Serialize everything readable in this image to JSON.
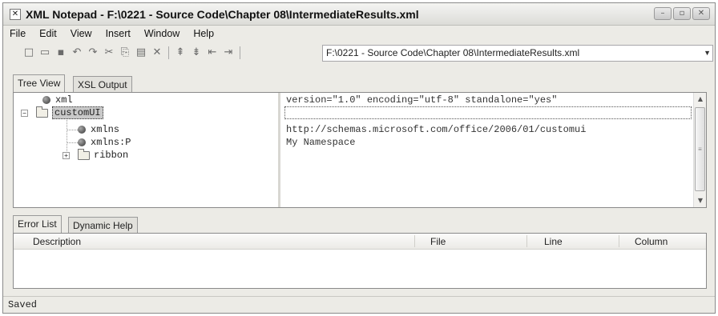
{
  "window": {
    "title": "XML Notepad - F:\\0221 - Source Code\\Chapter 08\\IntermediateResults.xml",
    "app_icon_glyph": "✕",
    "minimize_glyph": "–",
    "restore_glyph": "▫",
    "close_glyph": "✕"
  },
  "menu": [
    "File",
    "Edit",
    "View",
    "Insert",
    "Window",
    "Help"
  ],
  "toolbar": {
    "icons": [
      {
        "name": "new-file-icon",
        "glyph": "□"
      },
      {
        "name": "open-folder-icon",
        "glyph": "▭"
      },
      {
        "name": "save-icon",
        "glyph": "▪"
      },
      {
        "name": "undo-icon",
        "glyph": "↶"
      },
      {
        "name": "redo-icon",
        "glyph": "↷"
      },
      {
        "name": "cut-icon",
        "glyph": "✂"
      },
      {
        "name": "copy-icon",
        "glyph": "⎘"
      },
      {
        "name": "paste-icon",
        "glyph": "▤"
      },
      {
        "name": "delete-icon",
        "glyph": "✕"
      },
      {
        "name": "nudge-up-icon",
        "glyph": "⇞"
      },
      {
        "name": "nudge-down-icon",
        "glyph": "⇟"
      },
      {
        "name": "nudge-left-icon",
        "glyph": "⇤"
      },
      {
        "name": "nudge-right-icon",
        "glyph": "⇥"
      }
    ],
    "path_value": "F:\\0221 - Source Code\\Chapter 08\\IntermediateResults.xml",
    "path_dropdown_glyph": "▼"
  },
  "top_tabs": [
    "Tree View",
    "XSL Output"
  ],
  "tree": {
    "nodes": [
      "xml",
      "customUI",
      "xmlns",
      "xmlns:P",
      "ribbon"
    ],
    "collapse_glyph": "−",
    "expand_glyph": "+"
  },
  "values": [
    "version=\"1.0\" encoding=\"utf-8\" standalone=\"yes\"",
    "",
    "http://schemas.microsoft.com/office/2006/01/customui",
    "My Namespace"
  ],
  "scrollbar": {
    "up_glyph": "▲",
    "down_glyph": "▼",
    "grip_glyph": "≡"
  },
  "bottom_tabs": [
    "Error List",
    "Dynamic Help"
  ],
  "error_list": {
    "columns": [
      "Description",
      "File",
      "Line",
      "Column"
    ]
  },
  "status": "Saved"
}
